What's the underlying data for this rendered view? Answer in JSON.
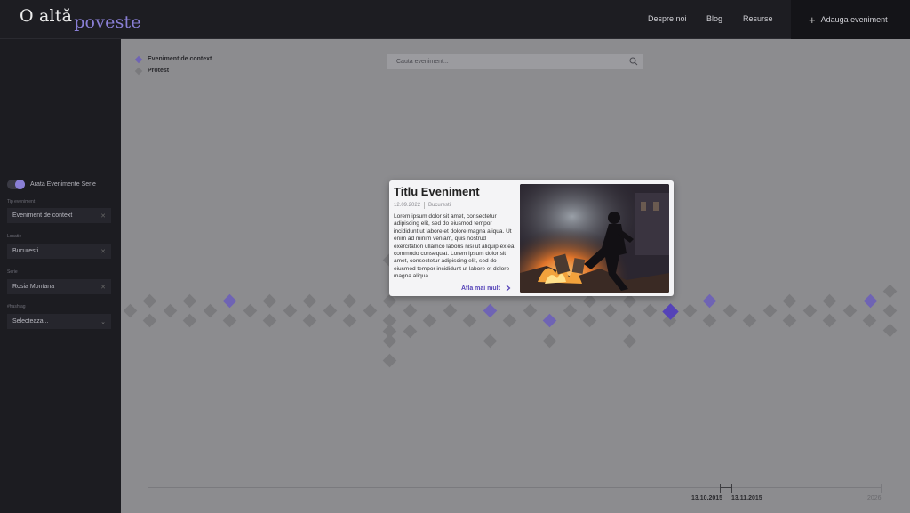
{
  "header": {
    "logo_line1": "O altă",
    "logo_line2": "poveste",
    "nav": [
      "Despre noi",
      "Blog",
      "Resurse"
    ],
    "add_event": "Adauga eveniment"
  },
  "sidebar": {
    "toggle_label": "Arata Evenimente Serie",
    "fields": [
      {
        "label": "Tip eveniment",
        "value": "Eveniment de context"
      },
      {
        "label": "Locatie",
        "value": "Bucuresti"
      },
      {
        "label": "Serie",
        "value": "Rosia Montana"
      },
      {
        "label": "#hashtag",
        "value": "Selecteaza..."
      }
    ]
  },
  "legend": [
    {
      "label": "Eveniment de context",
      "color": "#6f64b4"
    },
    {
      "label": "Protest",
      "color": "#7a7a7d"
    }
  ],
  "search": {
    "placeholder": "Cauta eveniment..."
  },
  "card": {
    "title": "Titlu Eveniment",
    "date": "12.09.2022",
    "location": "Bucuresti",
    "body": "Lorem ipsum dolor sit amet, consectetur adipiscing elit, sed do eiusmod tempor incididunt ut labore et dolore magna aliqua. Ut enim ad minim veniam, quis nostrud exercitation ullamco laboris nisi ut aliquip ex ea commodo consequat. Lorem ipsum dolor sit amet, consectetur adipiscing elit, sed do eiusmod tempor incididunt ut labore et dolore magna aliqua.",
    "more": "Afla mai mult"
  },
  "timeline": {
    "start": "13.10.2015",
    "end": "13.11.2015",
    "year_end": "2026"
  },
  "colors": {
    "accent": "#8a7fd6",
    "context": "#6f64b4",
    "protest": "#7a7a7d",
    "selected": "#5543b8"
  }
}
